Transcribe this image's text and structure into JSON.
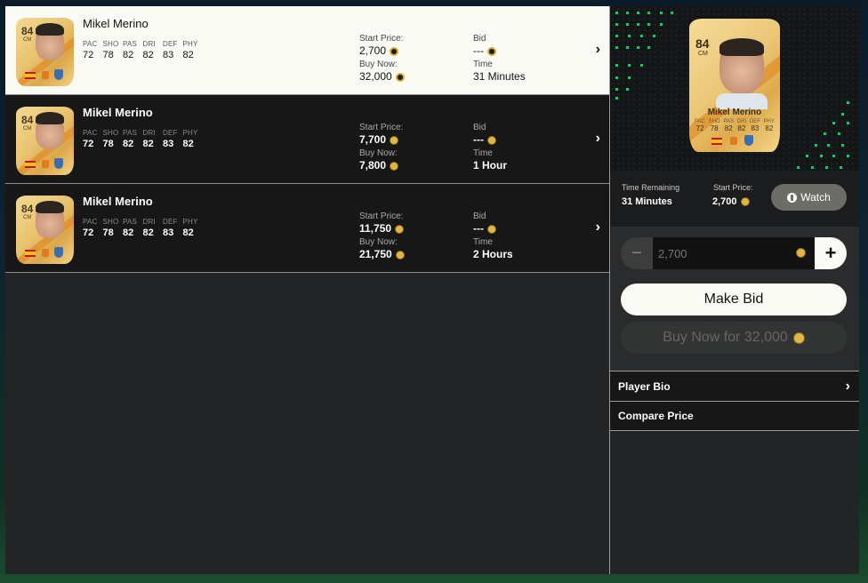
{
  "stat_labels": [
    "PAC",
    "SHO",
    "PAS",
    "DRI",
    "DEF",
    "PHY"
  ],
  "listings": [
    {
      "player": {
        "name": "Mikel Merino",
        "rating": "84",
        "position": "CM",
        "stats": [
          "72",
          "78",
          "82",
          "82",
          "83",
          "82"
        ]
      },
      "start_price_label": "Start Price:",
      "start_price": "2,700",
      "buy_now_label": "Buy Now:",
      "buy_now": "32,000",
      "bid_label": "Bid",
      "bid": "---",
      "time_label": "Time",
      "time": "31 Minutes",
      "selected": true
    },
    {
      "player": {
        "name": "Mikel Merino",
        "rating": "84",
        "position": "CM",
        "stats": [
          "72",
          "78",
          "82",
          "82",
          "83",
          "82"
        ]
      },
      "start_price_label": "Start Price:",
      "start_price": "7,700",
      "buy_now_label": "Buy Now:",
      "buy_now": "7,800",
      "bid_label": "Bid",
      "bid": "---",
      "time_label": "Time",
      "time": "1 Hour",
      "selected": false
    },
    {
      "player": {
        "name": "Mikel Merino",
        "rating": "84",
        "position": "CM",
        "stats": [
          "72",
          "78",
          "82",
          "82",
          "83",
          "82"
        ]
      },
      "start_price_label": "Start Price:",
      "start_price": "11,750",
      "buy_now_label": "Buy Now:",
      "buy_now": "21,750",
      "bid_label": "Bid",
      "bid": "---",
      "time_label": "Time",
      "time": "2 Hours",
      "selected": false
    }
  ],
  "detail": {
    "card": {
      "name": "Mikel Merino",
      "rating": "84",
      "position": "CM",
      "stats": [
        "72",
        "78",
        "82",
        "82",
        "83",
        "82"
      ]
    },
    "time_remaining_label": "Time Remaining",
    "time_remaining": "31 Minutes",
    "start_price_label": "Start Price:",
    "start_price": "2,700",
    "watch_label": "Watch",
    "bid_value": "2,700",
    "minus_label": "−",
    "plus_label": "+",
    "make_bid_label": "Make Bid",
    "buy_now_label": "Buy Now for 32,000",
    "menu": [
      {
        "label": "Player Bio",
        "has_chevron": true
      },
      {
        "label": "Compare Price",
        "has_chevron": false
      }
    ]
  },
  "icons": {
    "coin": "coin-icon",
    "chevron": "›",
    "watch": "watch-icon"
  },
  "colors": {
    "selected_row": "#fbfbf6",
    "row_bg": "#171718",
    "accent_green": "#21c56a",
    "coin_gold": "#d9a931"
  }
}
